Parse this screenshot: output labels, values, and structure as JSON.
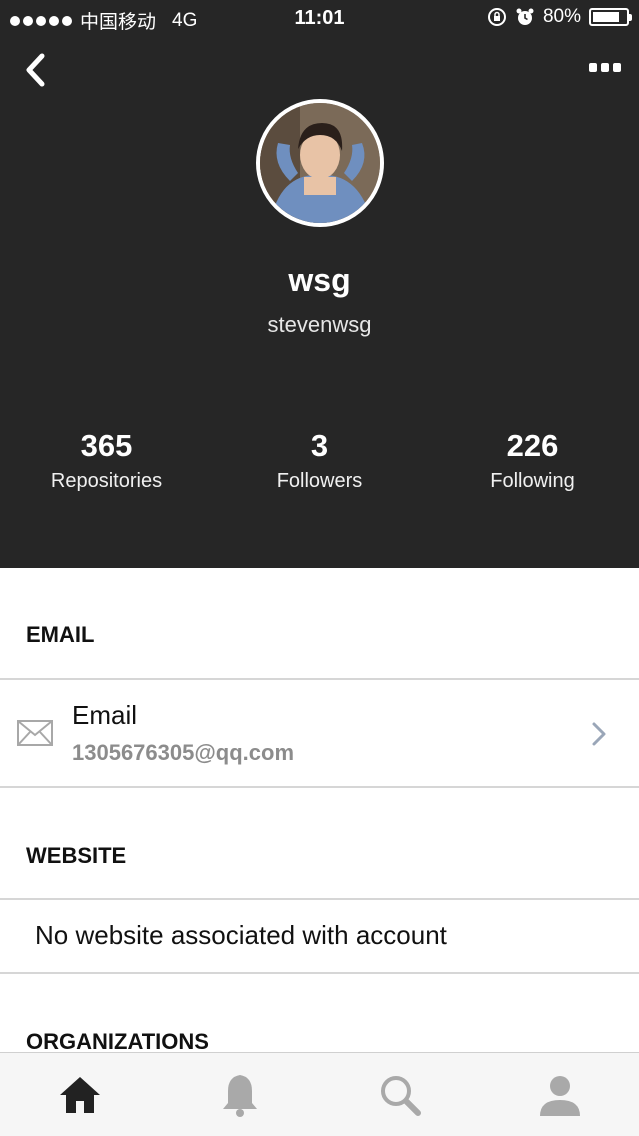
{
  "status_bar": {
    "carrier": "中国移动",
    "network": "4G",
    "time": "11:01",
    "battery_percent": "80%",
    "battery_level": 0.8,
    "icons": [
      "signal-dots-icon",
      "rotation-lock-icon",
      "alarm-icon",
      "battery-icon"
    ]
  },
  "nav": {
    "back_icon": "chevron-left-icon",
    "more_icon": "more-horizontal-icon"
  },
  "profile": {
    "display_name": "wsg",
    "username": "stevenwsg"
  },
  "stats": [
    {
      "value": "365",
      "label": "Repositories"
    },
    {
      "value": "3",
      "label": "Followers"
    },
    {
      "value": "226",
      "label": "Following"
    }
  ],
  "sections": {
    "email": {
      "title": "EMAIL",
      "label": "Email",
      "value": "1305676305@qq.com",
      "icon": "envelope-icon"
    },
    "website": {
      "title": "WEBSITE",
      "value": "No website associated with account"
    },
    "organizations": {
      "title": "ORGANIZATIONS"
    }
  },
  "tabbar": {
    "tabs": [
      {
        "icon": "home-icon",
        "active": true
      },
      {
        "icon": "bell-icon",
        "active": false
      },
      {
        "icon": "search-icon",
        "active": false
      },
      {
        "icon": "person-icon",
        "active": false
      }
    ],
    "colors": {
      "active": "#222222",
      "inactive": "#a9a9a9"
    }
  },
  "colors": {
    "header_bg": "#262626",
    "accent_gray": "#8c8c8c"
  }
}
